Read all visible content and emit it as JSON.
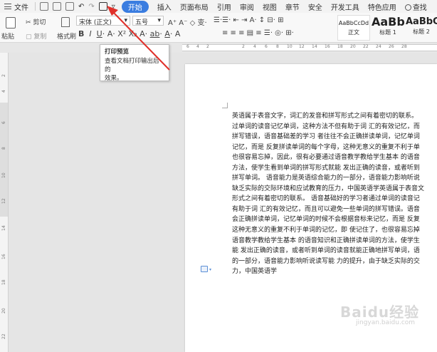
{
  "menu": {
    "file": "文件",
    "start": "开始",
    "tabs": [
      "插入",
      "页面布局",
      "引用",
      "审阅",
      "视图",
      "章节",
      "安全",
      "开发工具",
      "特色应用"
    ],
    "search": "查找"
  },
  "ribbon": {
    "cut": "剪切",
    "copy": "复制",
    "paste": "粘贴",
    "format_painter": "格式刷",
    "font_name": "宋体 (正文)",
    "font_size": "五号",
    "styles": [
      {
        "sample": "AaBbCcDd",
        "label": "正文"
      },
      {
        "sample": "AaBb",
        "label": "标题 1"
      },
      {
        "sample": "AaBbC",
        "label": "标题 2"
      }
    ]
  },
  "tooltip": {
    "title": "打印预览",
    "body_line1": "查看文档打印输出后的",
    "body_line2": "效果。"
  },
  "document": {
    "lines": [
      "英语属于表音文字，词汇的发音和拼写形式之间有着密切的联系。",
      "过单词的读音记忆单词，这种方法不但有助于词 汇的有效记忆，而",
      "拼写错误，语音基础差的学习 者往往不会正确拼读单词，记忆单词",
      "记忆，而是 反复拼读单词的每个字母，这种无意义的重复不利于单",
      "也很容易忘掉，因此，很有必要通过语音教学教给学生基本 的语音",
      "方法，使学生看到单词的拼写形式就能 发出正确的读音，或者听到",
      "拼写单词。 语音能力是英语综合能力的一部分，语音能力影响听说",
      "缺乏实际的交际环境和应试教育的压力，中国英语学英语属于表音文",
      "形式之间有着密切的联系。 语音基础好的学习者通过单词的读音记",
      "有助于词 汇的有效记忆，而且可以避免一些单词的拼写错误。语音",
      "会正确拼读单词，记忆单词的时候不会根据音标来记忆，而是 反复",
      "这种无意义的重复不利于单词的记忆，即 使记住了，也很容易忘掉",
      "语音教学教给学生基本 的语音知识和正确拼读单词的方法，使学生",
      "能 发出正确的读音，或者听到单词的读音就能正确地拼写单词，语",
      "的一部分，语音能力影响听说读写能 力的提升，由于缺乏实际的交",
      "力，中国英语学"
    ]
  },
  "ruler_numbers": [
    "6",
    "4",
    "2",
    "2",
    "4",
    "6",
    "8",
    "10",
    "12",
    "14",
    "16",
    "18",
    "20",
    "22",
    "24",
    "26",
    "28"
  ],
  "vruler_numbers": [
    "2",
    "4",
    "6",
    "8",
    "10",
    "12",
    "14",
    "16",
    "18",
    "20",
    "22"
  ],
  "watermark": {
    "text": "Baidu经验",
    "sub": "jingyan.baidu.com"
  },
  "colors": {
    "accent": "#3a7de0",
    "arrow": "#e0302a"
  }
}
